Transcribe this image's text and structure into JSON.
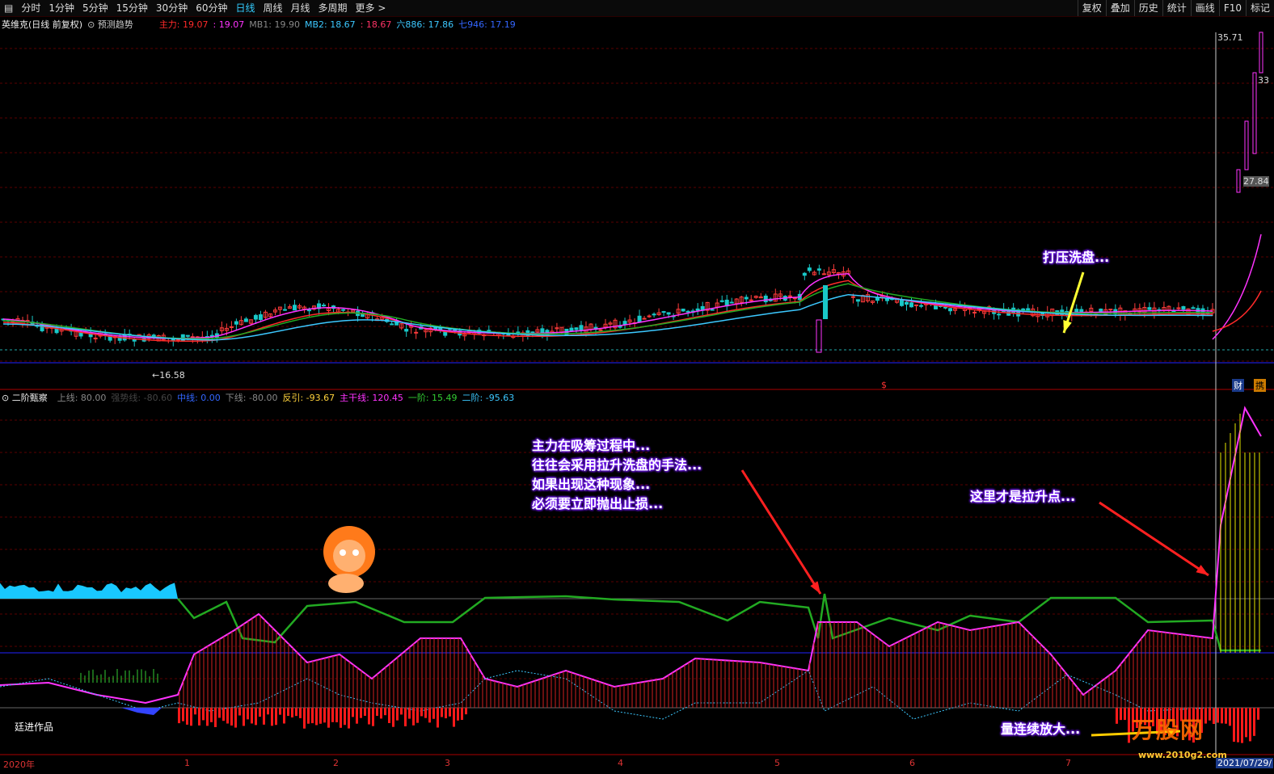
{
  "toolbar": {
    "items": [
      "分时",
      "1分钟",
      "5分钟",
      "15分钟",
      "30分钟",
      "60分钟",
      "日线",
      "周线",
      "月线",
      "多周期",
      "更多 >"
    ],
    "active_index": 6,
    "right_items": [
      "复权",
      "叠加",
      "历史",
      "统计",
      "画线",
      "F10",
      "标记"
    ]
  },
  "main_panel": {
    "title": "英维克(日线 前复权)",
    "predict": "预测趋势",
    "indicators": [
      {
        "label": "主力: 19.07",
        "color": "#ff2a2a"
      },
      {
        "label": ": 19.07",
        "color": "#ff33ff"
      },
      {
        "label": "MB1: 19.90",
        "color": "#888888"
      },
      {
        "label": "MB2: 18.67",
        "color": "#3cc8ff"
      },
      {
        "label": ": 18.67",
        "color": "#ff3366"
      },
      {
        "label": "六886: 17.86",
        "color": "#3cc8ff"
      },
      {
        "label": "七946: 17.19",
        "color": "#3366ff"
      }
    ],
    "low_label": "←16.58",
    "price_labels": [
      "35.71",
      "33",
      "27.84"
    ],
    "annotation": "打压洗盘...",
    "badges": [
      "财",
      "携"
    ],
    "marker": "$"
  },
  "sub_panel": {
    "title": "二阶甄察",
    "indicators": [
      {
        "label": "上线: 80.00",
        "color": "#888888"
      },
      {
        "label": "强势线: -80.60",
        "color": "#444444"
      },
      {
        "label": "中线: 0.00",
        "color": "#3366ff"
      },
      {
        "label": "下线: -80.00",
        "color": "#888888"
      },
      {
        "label": "反引: -93.67",
        "color": "#ffd23c"
      },
      {
        "label": "主干线: 120.45",
        "color": "#ff33ff"
      },
      {
        "label": "一阶: 15.49",
        "color": "#33cc33"
      },
      {
        "label": "二阶: -95.63",
        "color": "#3cc8ff"
      }
    ],
    "author": "廷进作品",
    "annotation_left": [
      "主力在吸筹过程中...",
      "往往会采用拉升洗盘的手法...",
      "如果出现这种现象...",
      "必须要立即抛出止损..."
    ],
    "annotation_right": "这里才是拉升点...",
    "annotation_volume": "量连续放大...",
    "watermark_text": "万股网",
    "watermark_url": "www.2010g2.com"
  },
  "time_axis": {
    "labels": [
      "2020年",
      "1",
      "2",
      "3",
      "4",
      "5",
      "6",
      "7"
    ],
    "end_date": "2021/07/29/"
  }
}
